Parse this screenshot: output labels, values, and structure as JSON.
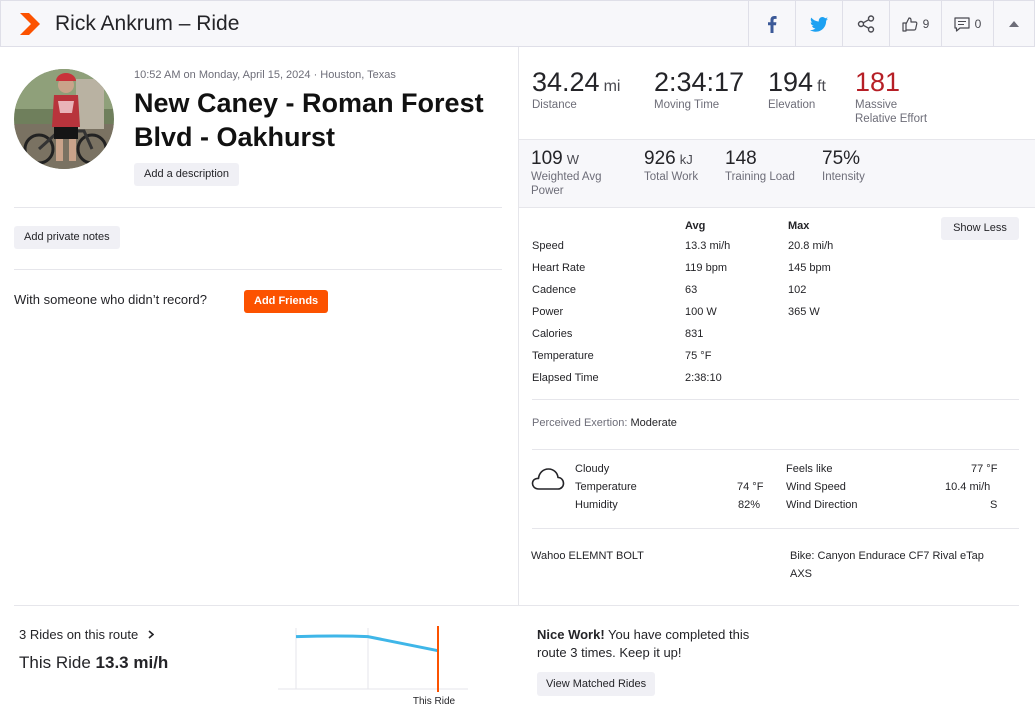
{
  "header": {
    "title": "Rick Ankrum – Ride",
    "kudos_count": "9",
    "comment_count": "0",
    "icons": [
      "strava-logo-icon",
      "facebook-icon",
      "twitter-icon",
      "share-icon",
      "thumbs-up-icon",
      "comment-icon",
      "collapse-icon"
    ]
  },
  "activity": {
    "datetime": "10:52 AM on Monday, April 15, 2024 · Houston, Texas",
    "name": "New Caney - Roman Forest Blvd - Oakhurst",
    "add_description": "Add a description",
    "add_private_notes": "Add private notes",
    "with_someone": "With someone who didn’t record?",
    "add_friends": "Add Friends"
  },
  "stats_top": [
    {
      "value": "34.24",
      "unit": "mi",
      "label": "Distance"
    },
    {
      "value": "2:34:17",
      "unit": "",
      "label": "Moving Time"
    },
    {
      "value": "194",
      "unit": "ft",
      "label": "Elevation"
    },
    {
      "value": "181",
      "unit": "",
      "label_line1": "Massive",
      "label_line2": "Relative Effort"
    }
  ],
  "stats_mid": [
    {
      "value": "109",
      "unit": "W",
      "label_line1": "Weighted Avg",
      "label_line2": "Power"
    },
    {
      "value": "926",
      "unit": "kJ",
      "label": "Total Work"
    },
    {
      "value": "148",
      "unit": "",
      "label": "Training Load"
    },
    {
      "value": "75%",
      "unit": "",
      "label": "Intensity"
    }
  ],
  "table": {
    "col_avg": "Avg",
    "col_max": "Max",
    "show_less": "Show Less",
    "rows": [
      {
        "label": "Speed",
        "avg": "13.3 mi/h",
        "max": "20.8 mi/h"
      },
      {
        "label": "Heart Rate",
        "avg": "119 bpm",
        "max": "145 bpm"
      },
      {
        "label": "Cadence",
        "avg": "63",
        "max": "102"
      },
      {
        "label": "Power",
        "avg": "100 W",
        "max": "365 W"
      },
      {
        "label": "Calories",
        "avg": "831",
        "max": ""
      },
      {
        "label": "Temperature",
        "avg": "75 °F",
        "max": ""
      },
      {
        "label": "Elapsed Time",
        "avg": "2:38:10",
        "max": ""
      }
    ]
  },
  "exertion": {
    "label": "Perceived Exertion:",
    "value": "Moderate"
  },
  "weather": {
    "condition": "Cloudy",
    "temperature_label": "Temperature",
    "temperature": "74 °F",
    "humidity_label": "Humidity",
    "humidity": "82%",
    "feels_like_label": "Feels like",
    "feels_like": "77 °F",
    "wind_speed_label": "Wind Speed",
    "wind_speed": "10.4 mi/h",
    "wind_direction_label": "Wind Direction",
    "wind_direction": "S"
  },
  "device": "Wahoo ELEMNT BOLT",
  "bike_line1": "Bike: Canyon Endurace CF7 Rival eTap",
  "bike_line2": "AXS",
  "bottom": {
    "rides_on_route": "3 Rides on this route",
    "this_ride_label": "This Ride",
    "this_ride_value": "13.3 mi/h",
    "nice_bold": "Nice Work!",
    "nice_rest": " You have completed this route 3 times. Keep it up!",
    "view_matched": "View Matched Rides",
    "chart_marker_label": "This Ride"
  },
  "chart_data": {
    "type": "line",
    "series": [
      {
        "values": [
          13.6,
          13.6,
          13.3
        ]
      }
    ],
    "marker_index": 2,
    "color": "#3fb6e8",
    "marker_color": "#fc5200"
  }
}
